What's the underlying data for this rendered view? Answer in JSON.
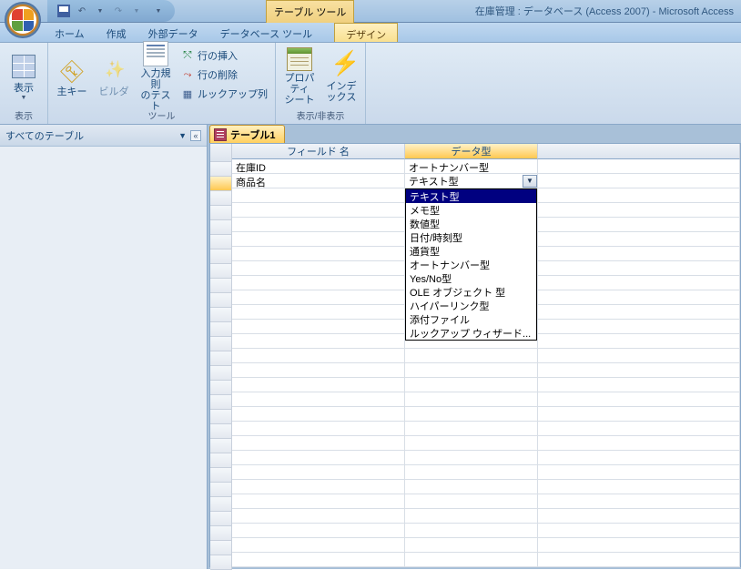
{
  "titlebar": {
    "context_title": "テーブル ツール",
    "db_title": "在庫管理 : データベース (Access 2007) - Microsoft Access"
  },
  "tabs": {
    "home": "ホーム",
    "create": "作成",
    "external": "外部データ",
    "dbtools": "データベース ツール",
    "design": "デザイン"
  },
  "ribbon": {
    "view": "表示",
    "view_group": "表示",
    "pkey": "主キー",
    "builder": "ビルダ",
    "test_rules": "入力規則\nのテスト",
    "insert_row": "行の挿入",
    "delete_row": "行の削除",
    "lookup_col": "ルックアップ列",
    "tools_group": "ツール",
    "prop_sheet": "プロパティ\nシート",
    "indexes": "インデックス",
    "showhide_group": "表示/非表示"
  },
  "navpane": {
    "title": "すべてのテーブル"
  },
  "doc": {
    "tab_name": "テーブル1",
    "col_field": "フィールド 名",
    "col_type": "データ型",
    "rows": [
      {
        "field": "在庫ID",
        "type": "オートナンバー型"
      },
      {
        "field": "商品名",
        "type": "テキスト型"
      }
    ],
    "dropdown": {
      "selected_index": 0,
      "items": [
        "テキスト型",
        "メモ型",
        "数値型",
        "日付/時刻型",
        "通貨型",
        "オートナンバー型",
        "Yes/No型",
        "OLE オブジェクト 型",
        "ハイパーリンク型",
        "添付ファイル",
        "ルックアップ ウィザード..."
      ]
    }
  }
}
